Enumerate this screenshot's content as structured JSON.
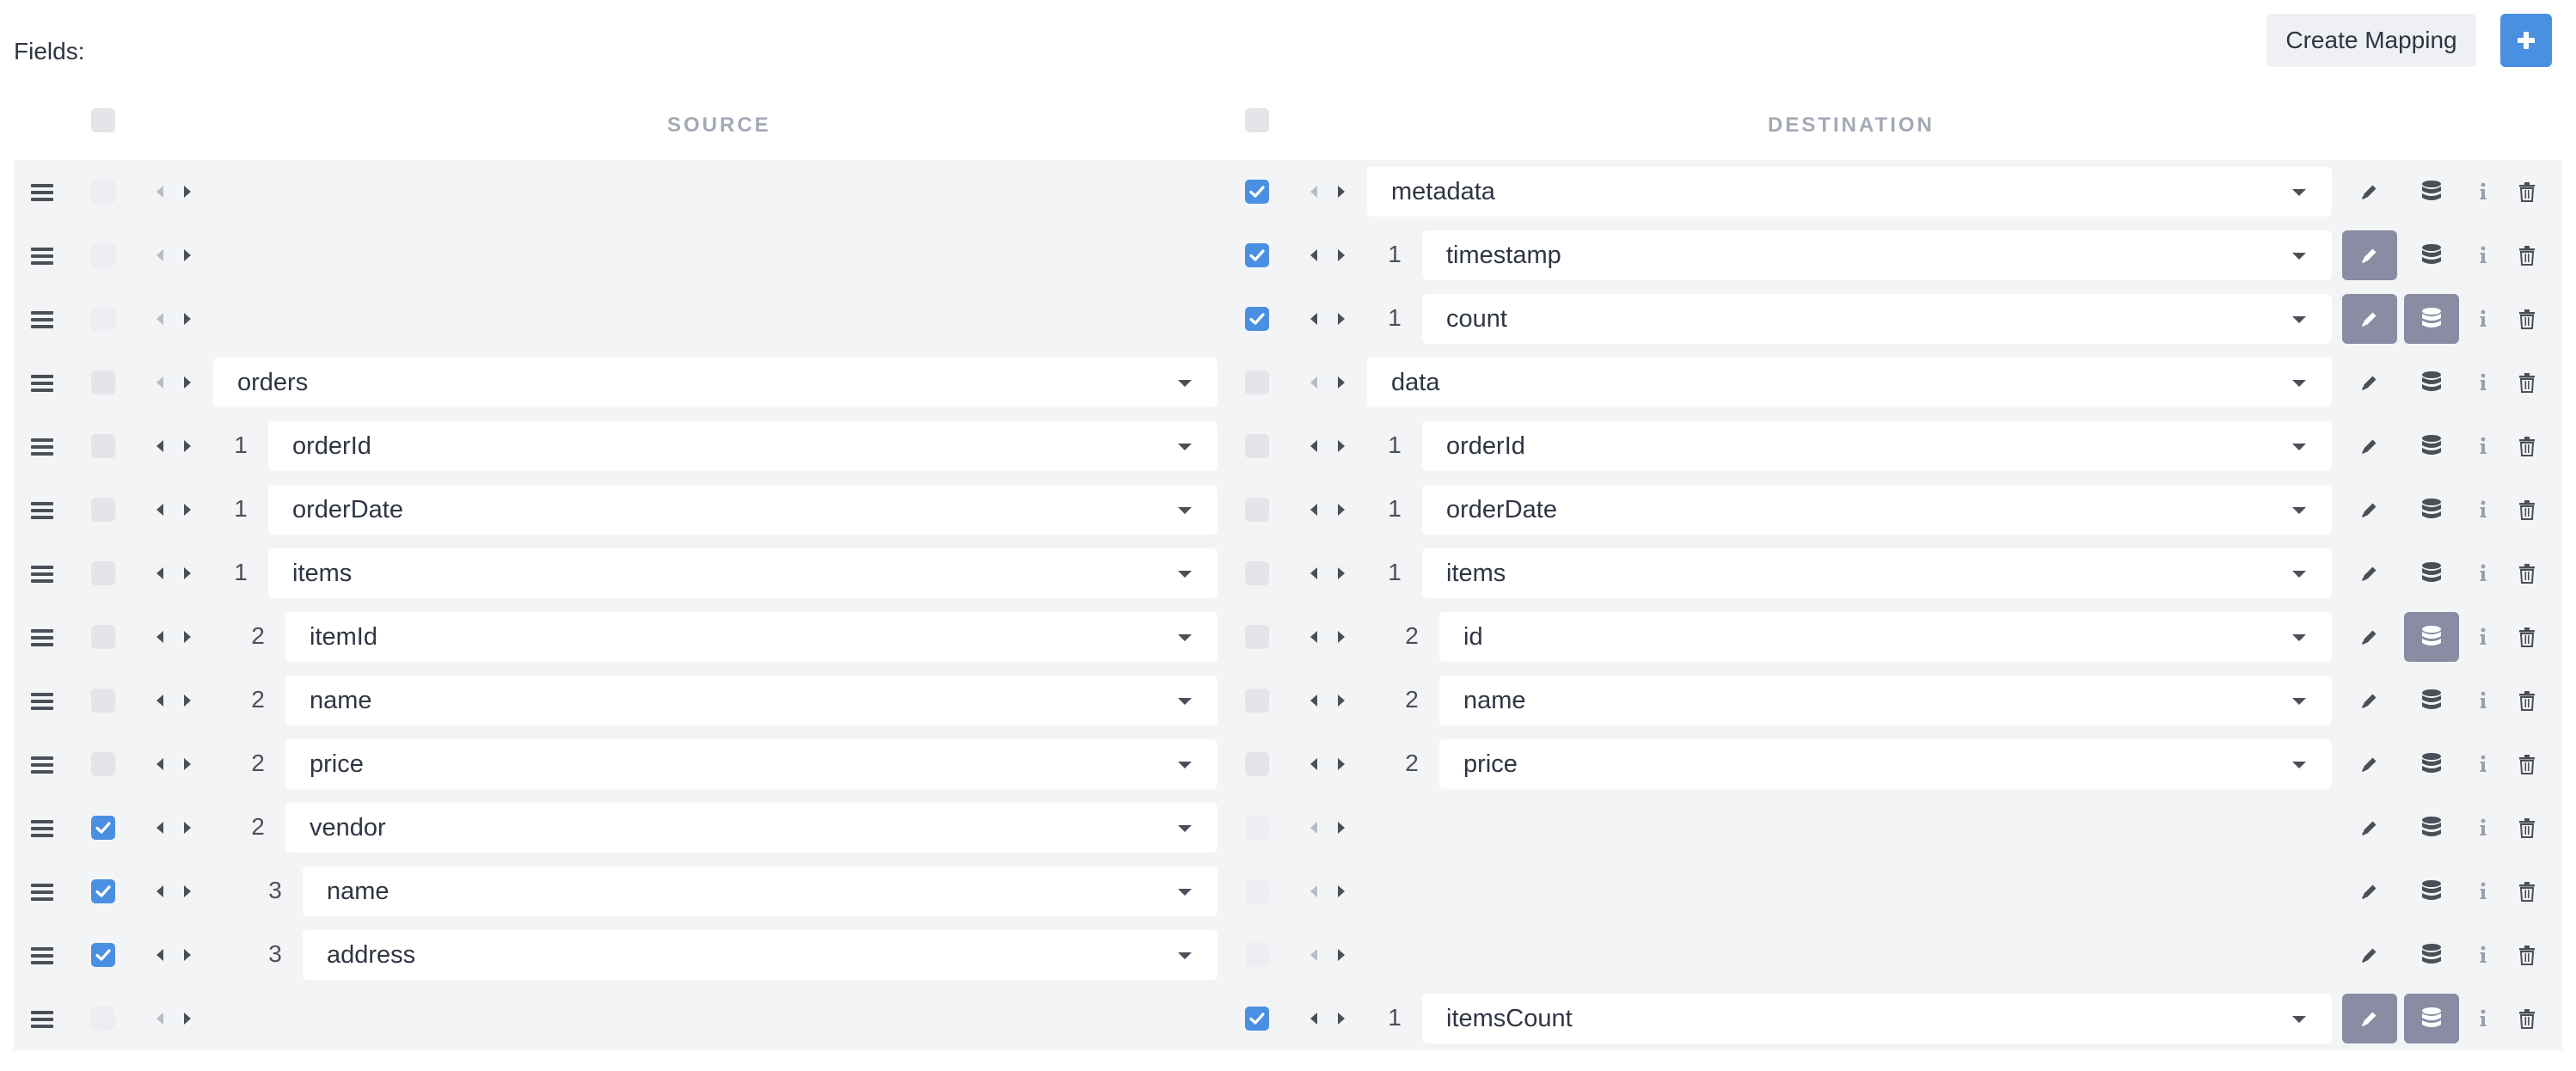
{
  "header": {
    "fields_label": "Fields:",
    "create_mapping_label": "Create Mapping",
    "add_icon": "plus-icon",
    "source_title": "SOURCE",
    "destination_title": "DESTINATION"
  },
  "colors": {
    "accent": "#4a90e2",
    "active_action": "#8a8ca3",
    "row_bg": "#f3f4f6"
  },
  "rows": [
    {
      "src": null,
      "src_checked": false,
      "dst": {
        "level": "",
        "value": "metadata"
      },
      "dst_checked": true,
      "edit_active": false,
      "db_active": false
    },
    {
      "src": null,
      "src_checked": false,
      "dst": {
        "level": "1",
        "value": "timestamp"
      },
      "dst_checked": true,
      "edit_active": true,
      "db_active": false
    },
    {
      "src": null,
      "src_checked": false,
      "dst": {
        "level": "1",
        "value": "count"
      },
      "dst_checked": true,
      "edit_active": true,
      "db_active": true
    },
    {
      "src": {
        "level": "",
        "value": "orders"
      },
      "src_checked": false,
      "dst": {
        "level": "",
        "value": "data"
      },
      "dst_checked": false,
      "edit_active": false,
      "db_active": false
    },
    {
      "src": {
        "level": "1",
        "value": "orderId"
      },
      "src_checked": false,
      "dst": {
        "level": "1",
        "value": "orderId"
      },
      "dst_checked": false,
      "edit_active": false,
      "db_active": false
    },
    {
      "src": {
        "level": "1",
        "value": "orderDate"
      },
      "src_checked": false,
      "dst": {
        "level": "1",
        "value": "orderDate"
      },
      "dst_checked": false,
      "edit_active": false,
      "db_active": false
    },
    {
      "src": {
        "level": "1",
        "value": "items"
      },
      "src_checked": false,
      "dst": {
        "level": "1",
        "value": "items"
      },
      "dst_checked": false,
      "edit_active": false,
      "db_active": false
    },
    {
      "src": {
        "level": "2",
        "value": "itemId"
      },
      "src_checked": false,
      "dst": {
        "level": "2",
        "value": "id"
      },
      "dst_checked": false,
      "edit_active": false,
      "db_active": true
    },
    {
      "src": {
        "level": "2",
        "value": "name"
      },
      "src_checked": false,
      "dst": {
        "level": "2",
        "value": "name"
      },
      "dst_checked": false,
      "edit_active": false,
      "db_active": false
    },
    {
      "src": {
        "level": "2",
        "value": "price"
      },
      "src_checked": false,
      "dst": {
        "level": "2",
        "value": "price"
      },
      "dst_checked": false,
      "edit_active": false,
      "db_active": false
    },
    {
      "src": {
        "level": "2",
        "value": "vendor"
      },
      "src_checked": true,
      "dst": null,
      "dst_checked": false,
      "edit_active": false,
      "db_active": false
    },
    {
      "src": {
        "level": "3",
        "value": "name"
      },
      "src_checked": true,
      "dst": null,
      "dst_checked": false,
      "edit_active": false,
      "db_active": false
    },
    {
      "src": {
        "level": "3",
        "value": "address"
      },
      "src_checked": true,
      "dst": null,
      "dst_checked": false,
      "edit_active": false,
      "db_active": false
    },
    {
      "src": null,
      "src_checked": false,
      "dst": {
        "level": "1",
        "value": "itemsCount"
      },
      "dst_checked": true,
      "edit_active": true,
      "db_active": true
    }
  ],
  "icons": [
    "drag-handle-icon",
    "chevron-left-icon",
    "chevron-right-icon",
    "dropdown-caret-icon",
    "pencil-icon",
    "database-icon",
    "info-icon",
    "trash-icon",
    "checkmark-icon"
  ]
}
